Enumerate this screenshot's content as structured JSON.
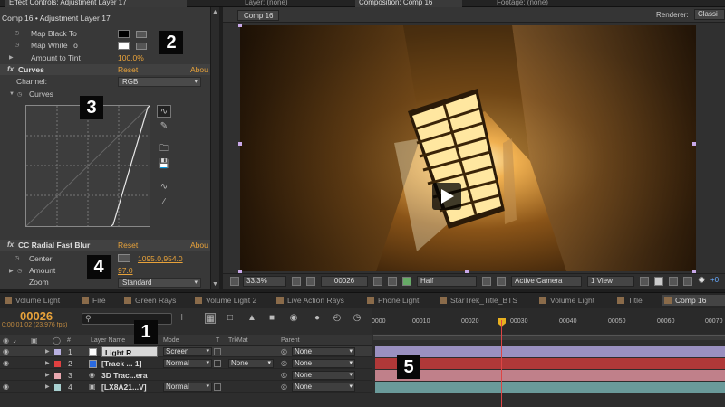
{
  "top_tabs": {
    "effect_controls": "Effect Controls: Adjustment Layer 17",
    "layer": "Layer: (none)",
    "composition": "Composition: Comp 16",
    "footage": "Footage: (none)"
  },
  "effect_controls": {
    "breadcrumb": "Comp 16 • Adjustment Layer 17",
    "tint": {
      "map_black": "Map Black To",
      "map_white": "Map White To",
      "amount_label": "Amount to Tint",
      "amount_value": "100.0%"
    },
    "curves": {
      "title": "Curves",
      "reset": "Reset",
      "about": "Abou",
      "channel_label": "Channel:",
      "channel_value": "RGB",
      "curves_label": "Curves"
    },
    "radial": {
      "title": "CC Radial Fast Blur",
      "reset": "Reset",
      "about": "Abou",
      "center_label": "Center",
      "center_value": "1095.0,954.0",
      "amount_label": "Amount",
      "amount_value": "97.0",
      "zoom_label": "Zoom",
      "zoom_value": "Standard"
    }
  },
  "composition": {
    "comp_tab": "Comp 16",
    "renderer_label": "Renderer:",
    "renderer_value": "Classi",
    "zoom": "33.3%",
    "frame": "00026",
    "resolution": "Half",
    "camera": "Active Camera",
    "view": "1 View",
    "exposure": "+0"
  },
  "timeline_tabs": [
    "Volume Light",
    "Fire",
    "Green Rays",
    "Volume Light 2",
    "Live Action Rays",
    "Phone Light",
    "StarTrek_Title_BTS",
    "Volume Light",
    "Title",
    "Comp 16"
  ],
  "timeline": {
    "timecode": "00026",
    "fps": "0:00:01:02 (23.976 fps)",
    "columns": {
      "num": "#",
      "layer_name": "Layer Name",
      "mode": "Mode",
      "t": "T",
      "trkmat": "TrkMat",
      "parent": "Parent"
    },
    "ruler": [
      "0000",
      "00010",
      "00020",
      "00030",
      "00040",
      "00050",
      "00060",
      "00070"
    ],
    "layers": [
      {
        "num": "1",
        "name": "Light R",
        "mode": "Screen",
        "trkmat": "",
        "parent": "None",
        "color": "#b8b0e0"
      },
      {
        "num": "2",
        "name": "[Track ... 1]",
        "mode": "Normal",
        "trkmat": "None",
        "parent": "None",
        "color": "#e04040"
      },
      {
        "num": "3",
        "name": "3D Trac...era",
        "mode": "",
        "trkmat": "",
        "parent": "None",
        "color": "#e8a8b0"
      },
      {
        "num": "4",
        "name": "[LX8A21...V]",
        "mode": "Normal",
        "trkmat": "",
        "parent": "None",
        "color": "#a8d0d0"
      }
    ]
  },
  "badges": [
    "1",
    "2",
    "3",
    "4",
    "5"
  ]
}
